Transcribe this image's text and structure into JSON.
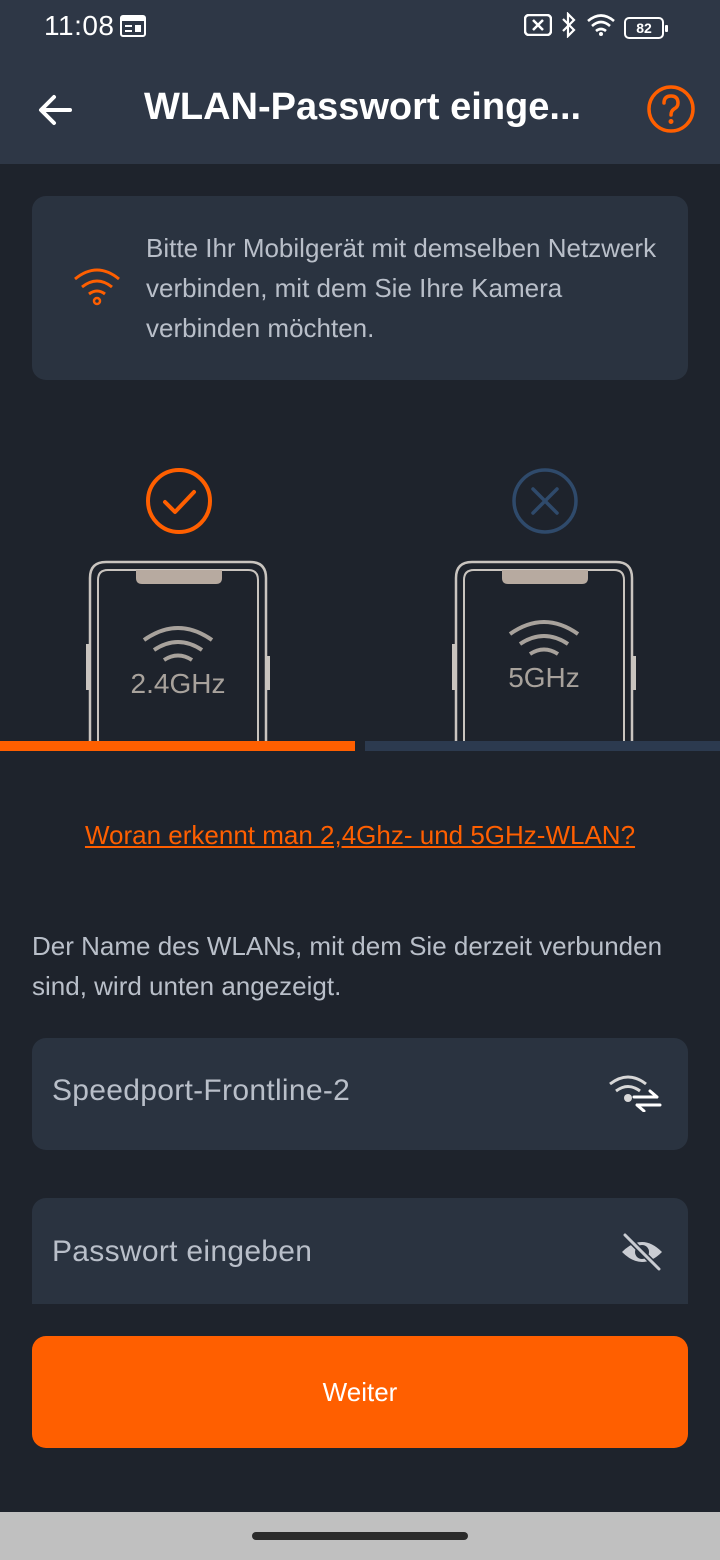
{
  "status_bar": {
    "time": "11:08",
    "battery": "82"
  },
  "app_bar": {
    "title": "WLAN-Passwort einge..."
  },
  "info": {
    "text": "Bitte Ihr Mobilgerät mit demselben Netzwerk verbinden, mit dem Sie Ihre Kamera verbinden möchten."
  },
  "bands": [
    {
      "label": "2.4GHz",
      "supported": true
    },
    {
      "label": "5GHz",
      "supported": false
    }
  ],
  "help_link": "Woran erkennt man 2,4Ghz- und 5GHz-WLAN?",
  "description": "Der Name des WLANs, mit dem Sie derzeit verbunden sind, wird unten angezeigt.",
  "ssid_field": {
    "value": "Speedport-Frontline-2",
    "icon": "wifi-switch-icon"
  },
  "password_field": {
    "placeholder": "Passwort eingeben",
    "value": "",
    "icon": "eye-off-icon"
  },
  "next_button": {
    "label": "Weiter"
  },
  "colors": {
    "accent": "#ff5f00",
    "background": "#1e232c",
    "header": "#2e3746",
    "card": "#2a3340",
    "inactive": "#2c3a4f"
  }
}
